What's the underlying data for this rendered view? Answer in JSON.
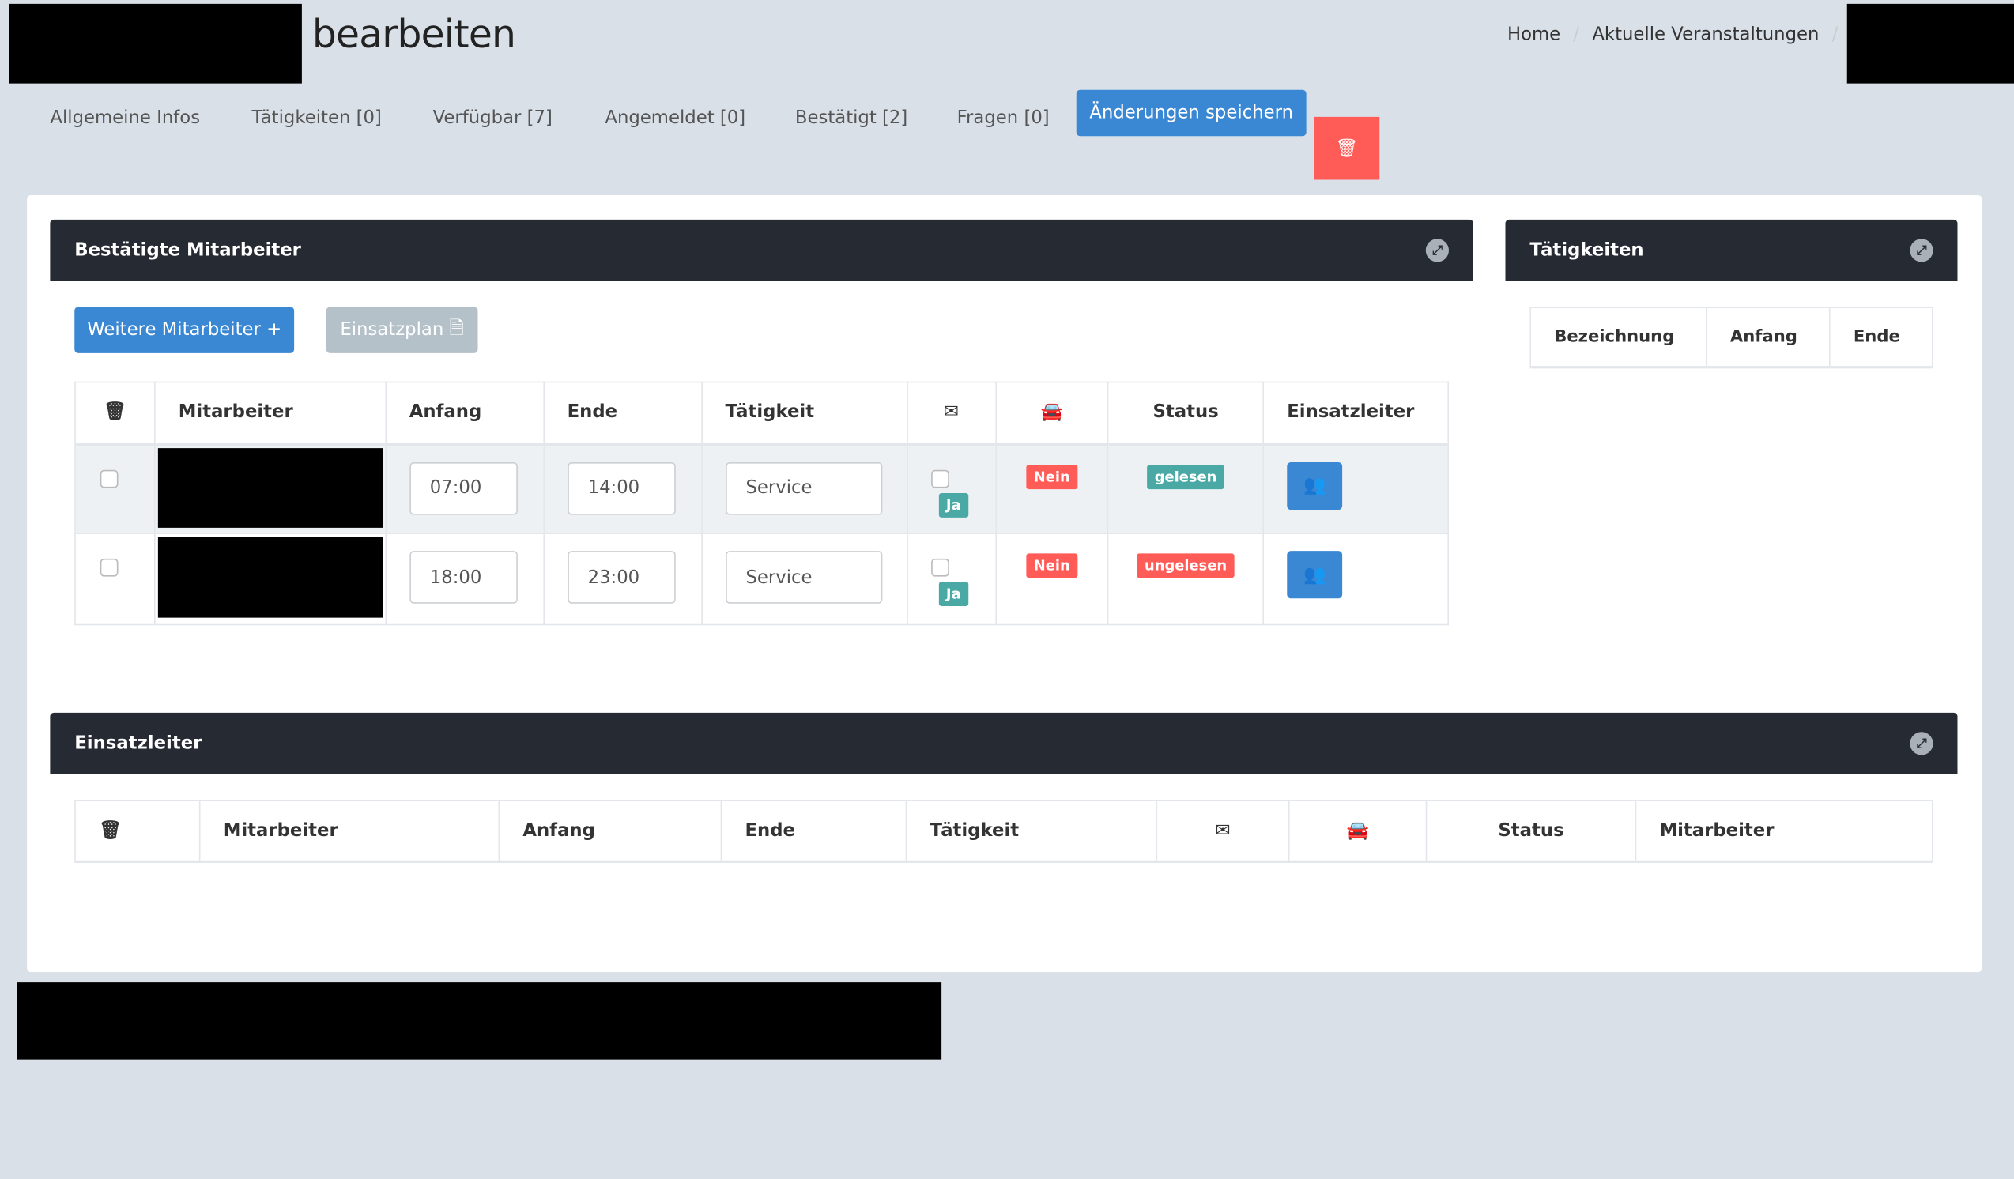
{
  "header": {
    "title": "bearbeiten",
    "breadcrumb": [
      "Home",
      "Aktuelle Veranstaltungen"
    ],
    "separator": "/"
  },
  "tabs": [
    "Allgemeine Infos",
    "Tätigkeiten [0]",
    "Verfügbar [7]",
    "Angemeldet [0]",
    "Bestätigt [2]",
    "Fragen [0]"
  ],
  "actions": {
    "save_label": "Änderungen speichern",
    "delete_icon": "trash-icon"
  },
  "colors": {
    "primary": "#3a87d4",
    "danger": "#ff5b57",
    "success": "#4aa9a5",
    "panel_header": "#262a33",
    "disabled": "#b4c1c9"
  },
  "confirmed": {
    "title": "Bestätigte Mitarbeiter",
    "add_label": "Weitere Mitarbeiter",
    "plan_label": "Einsatzplan",
    "columns": [
      "Mitarbeiter",
      "Anfang",
      "Ende",
      "Tätigkeit",
      "Status",
      "Einsatzleiter"
    ],
    "rows": [
      {
        "start": "07:00",
        "end": "14:00",
        "activity": "Service",
        "mail_badge": "Ja",
        "car": "Nein",
        "status": "gelesen",
        "status_color": "#4aa9a5"
      },
      {
        "start": "18:00",
        "end": "23:00",
        "activity": "Service",
        "mail_badge": "Ja",
        "car": "Nein",
        "status": "ungelesen",
        "status_color": "#ff5b57"
      }
    ]
  },
  "activities": {
    "title": "Tätigkeiten",
    "columns": [
      "Bezeichnung",
      "Anfang",
      "Ende"
    ]
  },
  "leaders": {
    "title": "Einsatzleiter",
    "columns": [
      "Mitarbeiter",
      "Anfang",
      "Ende",
      "Tätigkeit",
      "Status",
      "Mitarbeiter"
    ]
  }
}
